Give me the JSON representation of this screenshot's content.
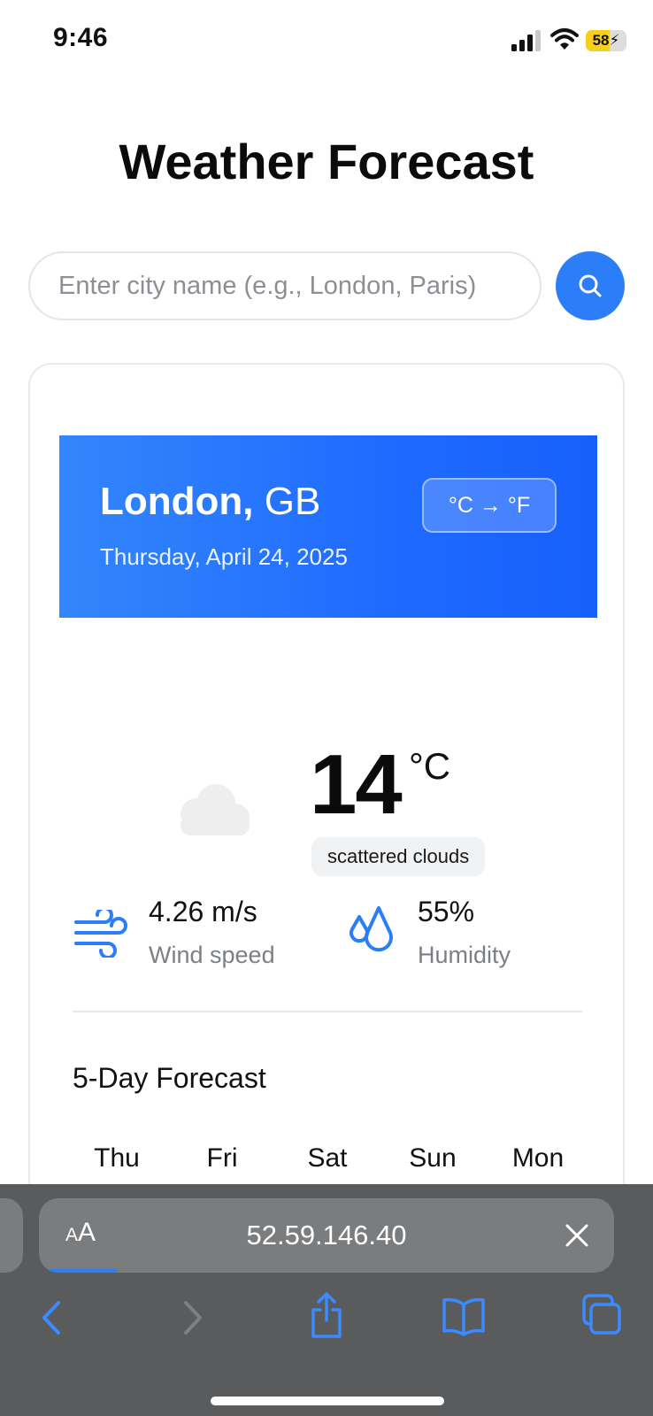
{
  "status_bar": {
    "time": "9:46",
    "battery_percent": "58",
    "battery_level": 0.58,
    "battery_color": "#f5d01b"
  },
  "app": {
    "title": "Weather Forecast",
    "search": {
      "placeholder": "Enter city name (e.g., London, Paris)",
      "value": ""
    },
    "search_button_icon": "search-icon",
    "accent_color": "#2c7ef8"
  },
  "current": {
    "city": "London,",
    "country": "GB",
    "date": "Thursday, April 24, 2025",
    "unit_toggle_label": "°C → °F",
    "condition_icon": "cloud-icon",
    "temperature": "14",
    "temperature_unit": "°C",
    "condition": "scattered clouds",
    "wind": {
      "icon": "wind-icon",
      "value": "4.26 m/s",
      "label": "Wind speed"
    },
    "humidity": {
      "icon": "humidity-icon",
      "value": "55%",
      "label": "Humidity"
    }
  },
  "forecast": {
    "title": "5-Day Forecast",
    "days": [
      "Thu",
      "Fri",
      "Sat",
      "Sun",
      "Mon"
    ]
  },
  "browser": {
    "aa_small": "A",
    "aa_large": "A",
    "url": "52.59.146.40",
    "icons": [
      "chevron-left-icon",
      "chevron-right-icon",
      "share-icon",
      "book-icon",
      "tabs-icon",
      "close-icon"
    ]
  }
}
